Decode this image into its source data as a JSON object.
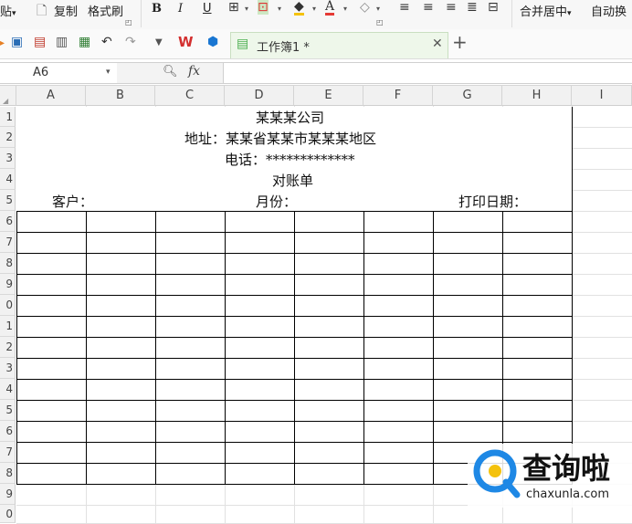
{
  "ribbon": {
    "paste_partial": "贴",
    "copy": "复制",
    "format_painter": "格式刷",
    "bold": "B",
    "italic": "I",
    "underline": "U",
    "merge_center": "合并居中",
    "auto_wrap": "自动换"
  },
  "tab": {
    "label": "工作簿1 *"
  },
  "formula_bar": {
    "cell_ref": "A6",
    "fx": "fx",
    "formula": ""
  },
  "columns": [
    "A",
    "B",
    "C",
    "D",
    "E",
    "F",
    "G",
    "H",
    "I"
  ],
  "rows": [
    "1",
    "2",
    "3",
    "4",
    "5",
    "6",
    "7",
    "8",
    "9",
    "0",
    "1",
    "2",
    "3",
    "4",
    "5",
    "6",
    "7",
    "8",
    "9",
    "0"
  ],
  "sheet": {
    "company": "某某某公司",
    "address": "地址：某某省某某市某某某地区",
    "phone": "电话：*************",
    "title": "对账单",
    "customer": "客户：",
    "month": "月份：",
    "print_date": "打印日期："
  },
  "watermark": {
    "text": "查询啦",
    "url": "chaxunla.com",
    "color": "#1e88e5"
  }
}
